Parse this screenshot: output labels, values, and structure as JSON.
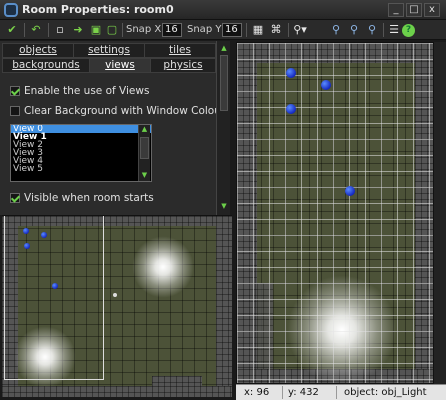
{
  "window": {
    "title": "Room Properties: room0",
    "minimize": "_",
    "maximize": "□",
    "close": "x"
  },
  "toolbar": {
    "snap_x_label": "Snap X",
    "snap_x_value": "16",
    "snap_y_label": "Snap Y",
    "snap_y_value": "16"
  },
  "tabs": {
    "row1": [
      "objects",
      "settings",
      "tiles"
    ],
    "row2": [
      "backgrounds",
      "views",
      "physics"
    ],
    "active": "views"
  },
  "views_panel": {
    "enable_views": {
      "label": "Enable the use of Views",
      "checked": true
    },
    "clear_background": {
      "label": "Clear Background with Window Colour",
      "checked": false
    },
    "view_list": [
      "View 0",
      "View 1",
      "View 2",
      "View 3",
      "View 4",
      "View 5"
    ],
    "selected_view": "View 0",
    "visible_on_start": {
      "label": "Visible when room starts",
      "checked": true
    }
  },
  "status_bar": {
    "x": "x: 96",
    "y": "y: 432",
    "object": "object: obj_Light"
  }
}
